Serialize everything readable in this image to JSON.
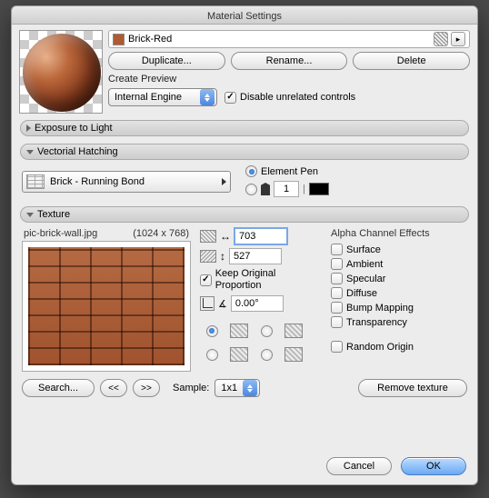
{
  "window": {
    "title": "Material Settings"
  },
  "material": {
    "name": "Brick-Red",
    "buttons": {
      "duplicate": "Duplicate...",
      "rename": "Rename...",
      "delete": "Delete"
    },
    "create_preview_label": "Create Preview",
    "engine_select": "Internal Engine",
    "disable_unrelated": {
      "label": "Disable unrelated controls",
      "checked": true
    }
  },
  "sections": {
    "exposure": {
      "title": "Exposure to Light",
      "open": false
    },
    "hatching": {
      "title": "Vectorial Hatching",
      "pattern": "Brick - Running Bond",
      "element_pen": {
        "label": "Element Pen",
        "selected": true
      },
      "custom_pen": {
        "value": "1"
      }
    },
    "texture": {
      "title": "Texture",
      "file": "pic-brick-wall.jpg",
      "dims": "(1024 x 768)",
      "width": "703",
      "height": "527",
      "keep_proportion": {
        "label": "Keep Original Proportion",
        "checked": true
      },
      "angle": "0.00°",
      "alpha_label": "Alpha Channel Effects",
      "alpha": {
        "surface": "Surface",
        "ambient": "Ambient",
        "specular": "Specular",
        "diffuse": "Diffuse",
        "bump": "Bump Mapping",
        "transparency": "Transparency"
      },
      "random_origin": "Random Origin",
      "search": "Search...",
      "prev": "<<",
      "next": ">>",
      "sample_label": "Sample:",
      "sample_value": "1x1",
      "remove": "Remove texture"
    }
  },
  "footer": {
    "cancel": "Cancel",
    "ok": "OK"
  }
}
